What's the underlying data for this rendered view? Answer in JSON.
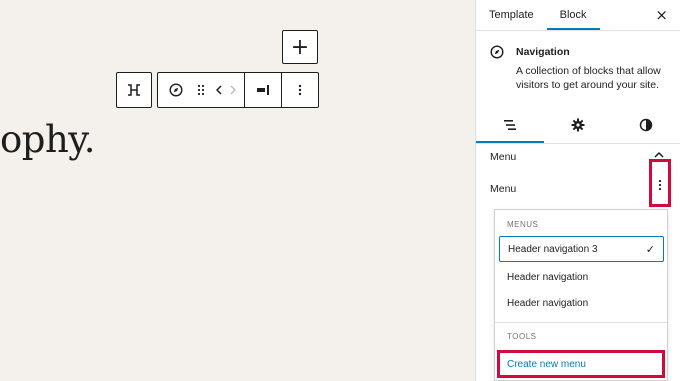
{
  "canvas": {
    "heading_text": "ophy.",
    "add_block_label": "+"
  },
  "toolbar": {
    "icons": [
      "transform-icon",
      "navigation-compass-icon",
      "drag-handle-icon",
      "move-arrows-icon",
      "justify-icon",
      "more-options-icon"
    ]
  },
  "sidebar": {
    "tabs": [
      {
        "label": "Template",
        "active": false
      },
      {
        "label": "Block",
        "active": true
      }
    ],
    "close_label": "×",
    "block": {
      "title": "Navigation",
      "description": "A collection of blocks that allow visitors to get around your site."
    },
    "settings_tabs": [
      "list-view-icon",
      "gear-icon",
      "styles-icon"
    ],
    "menu_heading": "Menu",
    "menu_label": "Menu"
  },
  "dropdown": {
    "menus_group_label": "MENUS",
    "items": [
      {
        "label": "Header navigation 3",
        "selected": true
      },
      {
        "label": "Header navigation",
        "selected": false
      },
      {
        "label": "Header navigation",
        "selected": false
      }
    ],
    "check": "✓",
    "tools_group_label": "TOOLS",
    "create_label": "Create new menu"
  },
  "colors": {
    "accent": "#007cba",
    "highlight": "#d00b3c",
    "canvas_bg": "#f4f1ec"
  }
}
